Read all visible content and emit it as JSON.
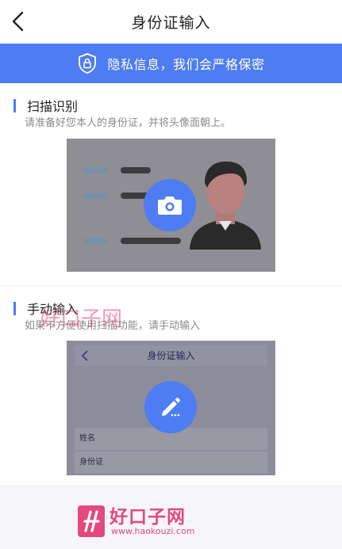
{
  "header": {
    "title": "身份证输入"
  },
  "privacy_banner": {
    "text": "隐私信息，我们会严格保密"
  },
  "scan_section": {
    "title": "扫描识别",
    "subtitle": "请准备好您本人的身份证，并将头像面朝上。"
  },
  "manual_section": {
    "title": "手动输入",
    "subtitle": "如果不方便使用扫描功能，请手动输入",
    "preview": {
      "title": "身份证输入",
      "fields": [
        "姓名",
        "身份证"
      ]
    }
  },
  "watermark": {
    "overlay_text": "好口子网",
    "name": "好口子网",
    "url": "www.haokouzi.com"
  },
  "colors": {
    "accent": "#4e7cf2",
    "watermark": "#e4487e"
  },
  "icons": {
    "back": "chevron-left-icon",
    "lock": "lock-shield-icon",
    "camera": "camera-icon",
    "edit": "pencil-icon"
  }
}
